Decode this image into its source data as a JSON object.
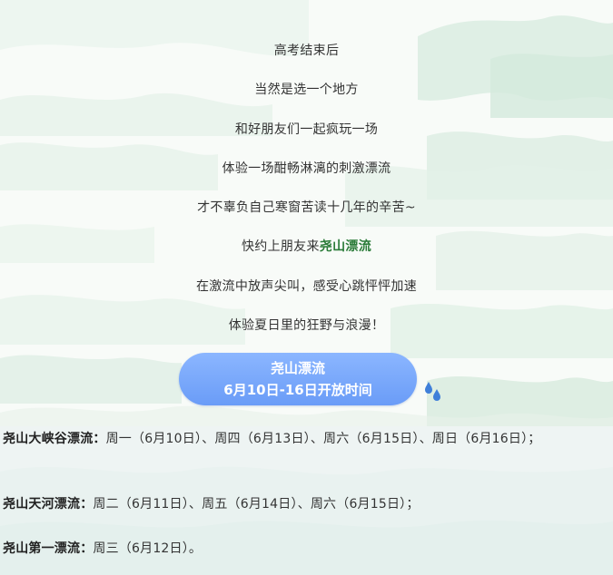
{
  "intro_lines": [
    "高考结束后",
    "当然是选一个地方",
    "和好朋友们一起疯玩一场",
    "体验一场酣畅淋漓的刺激漂流",
    "才不辜负自己寒窗苦读十几年的辛苦~"
  ],
  "invite": {
    "prefix": "快约上朋友来",
    "highlight": "尧山漂流"
  },
  "outro_lines": [
    "在激流中放声尖叫，感受心跳怦怦加速",
    "体验夏日里的狂野与浪漫！"
  ],
  "banner": {
    "title": "尧山漂流",
    "subtitle": "6月10日-16日开放时间"
  },
  "schedule": [
    {
      "name": "尧山大峡谷漂流：",
      "days": "周一（6月10日）、周四（6月13日）、周六（6月15日）、周日（6月16日）；"
    },
    {
      "name": "尧山天河漂流：",
      "days": "周二（6月11日）、周五（6月14日）、周六（6月15日）；"
    },
    {
      "name": "尧山第一漂流：",
      "days": "周三（6月12日）。"
    }
  ],
  "colors": {
    "highlight": "#2a7b38",
    "banner_gradient_top": "#8bb6ff",
    "banner_gradient_bottom": "#6a9cf7",
    "drop": "#3f7fd9",
    "mountain": "#c9e6d6"
  },
  "icons": {
    "drops": "water-drops-icon"
  }
}
